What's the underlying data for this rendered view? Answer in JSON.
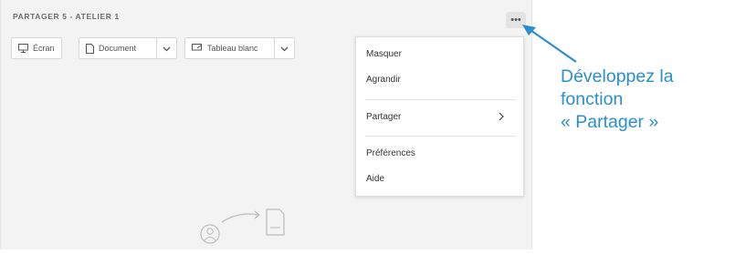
{
  "pod": {
    "title": "PARTAGER 5 - ATELIER 1",
    "more_label": "•••"
  },
  "toolbar": {
    "screen_label": "Écran",
    "document_label": "Document",
    "whiteboard_label": "Tableau blanc"
  },
  "menu": {
    "hide": "Masquer",
    "maximize": "Agrandir",
    "share": "Partager",
    "preferences": "Préférences",
    "help": "Aide"
  },
  "callout": {
    "line1": "Développez la",
    "line2": "fonction",
    "line3": "« Partager »",
    "color": "#2a8fce"
  }
}
